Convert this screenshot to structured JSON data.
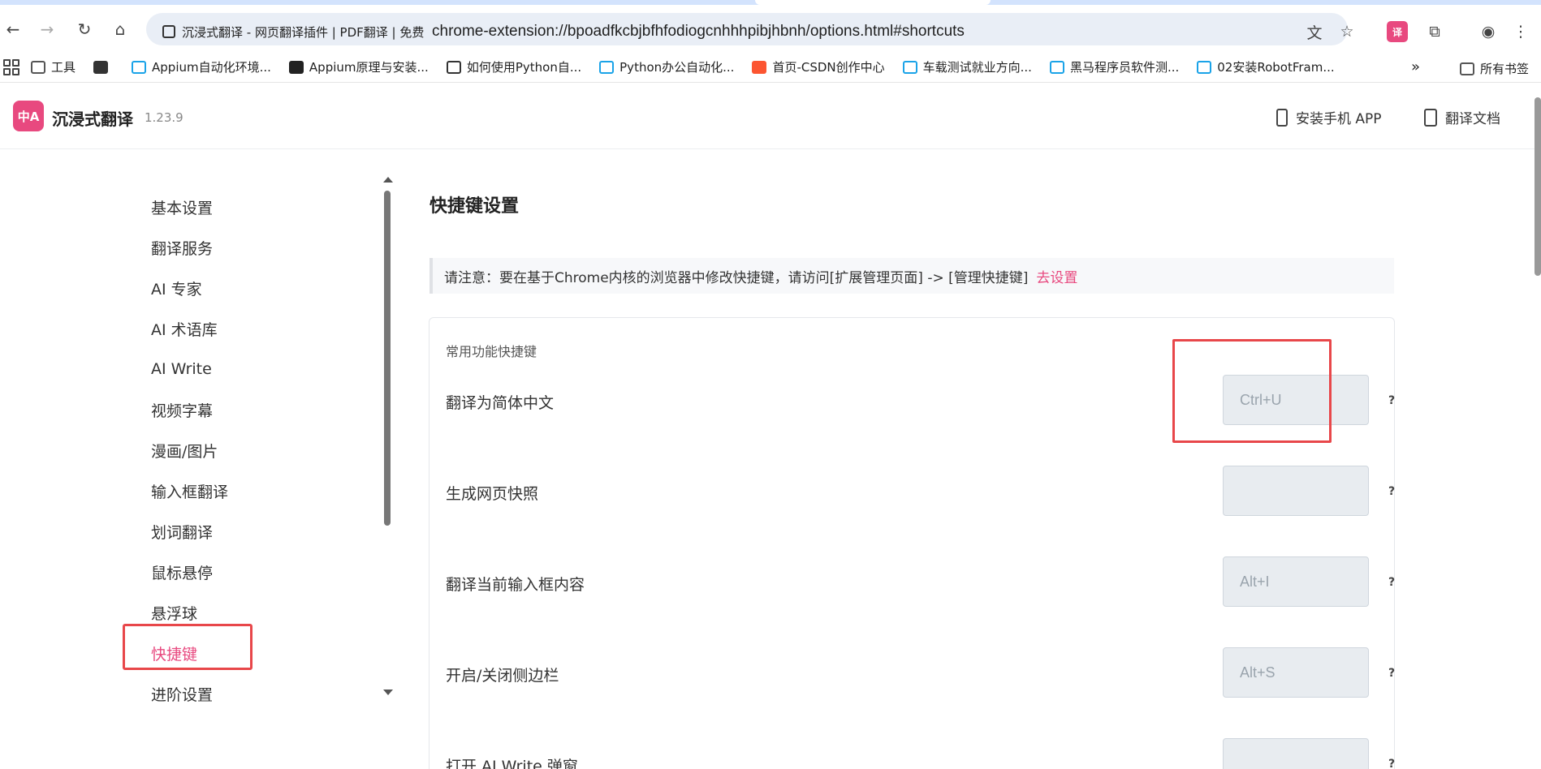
{
  "browser": {
    "tab_title": "沉浸式翻译 - 网页翻译插件 | PDF翻译 | 免费",
    "url": "chrome-extension://bpoadfkcbjbfhfodiogcnhhhpibjhbnh/options.html#shortcuts",
    "extension_badge": "译"
  },
  "bookmarks": [
    {
      "label": "工具",
      "icon": "folder-icon"
    },
    {
      "label": "",
      "icon": "globe-icon"
    },
    {
      "label": "Appium自动化环境...",
      "icon": "bilibili-icon"
    },
    {
      "label": "Appium原理与安装...",
      "icon": "appium-icon"
    },
    {
      "label": "如何使用Python自...",
      "icon": "page-icon"
    },
    {
      "label": "Python办公自动化...",
      "icon": "bilibili-icon"
    },
    {
      "label": "首页-CSDN创作中心",
      "icon": "csdn-icon"
    },
    {
      "label": "车载测试就业方向...",
      "icon": "bilibili-icon"
    },
    {
      "label": "黑马程序员软件测...",
      "icon": "bilibili-icon"
    },
    {
      "label": "02安装RobotFram...",
      "icon": "bilibili-icon"
    }
  ],
  "bookmarks_overflow": "»",
  "bookmarks_all": "所有书签",
  "header": {
    "logo_text": "中A",
    "app_name": "沉浸式翻译",
    "version": "1.23.9",
    "install_app": "安装手机 APP",
    "translate_docs": "翻译文档"
  },
  "sidebar": {
    "items": [
      {
        "label": "基本设置"
      },
      {
        "label": "翻译服务"
      },
      {
        "label": "AI 专家"
      },
      {
        "label": "AI 术语库"
      },
      {
        "label": "AI Write"
      },
      {
        "label": "视频字幕"
      },
      {
        "label": "漫画/图片"
      },
      {
        "label": "输入框翻译"
      },
      {
        "label": "划词翻译"
      },
      {
        "label": "鼠标悬停"
      },
      {
        "label": "悬浮球"
      },
      {
        "label": "快捷键"
      },
      {
        "label": "进阶设置"
      }
    ],
    "active_index": 11
  },
  "main": {
    "title": "快捷键设置",
    "notice_text": "请注意：要在基于Chrome内核的浏览器中修改快捷键，请访问[扩展管理页面] -> [管理快捷键]",
    "notice_link": "去设置",
    "section_caption": "常用功能快捷键",
    "shortcuts": [
      {
        "label": "翻译为简体中文",
        "key": "Ctrl+U",
        "help": "?"
      },
      {
        "label": "生成网页快照",
        "key": "",
        "help": "?"
      },
      {
        "label": "翻译当前输入框内容",
        "key": "Alt+I",
        "help": "?"
      },
      {
        "label": "开启/关闭侧边栏",
        "key": "Alt+S",
        "help": "?"
      },
      {
        "label": "打开 AI Write 弹窗",
        "key": "",
        "help": "?"
      }
    ]
  },
  "colors": {
    "accent": "#e8497f",
    "annotation_red": "#e8474a"
  }
}
